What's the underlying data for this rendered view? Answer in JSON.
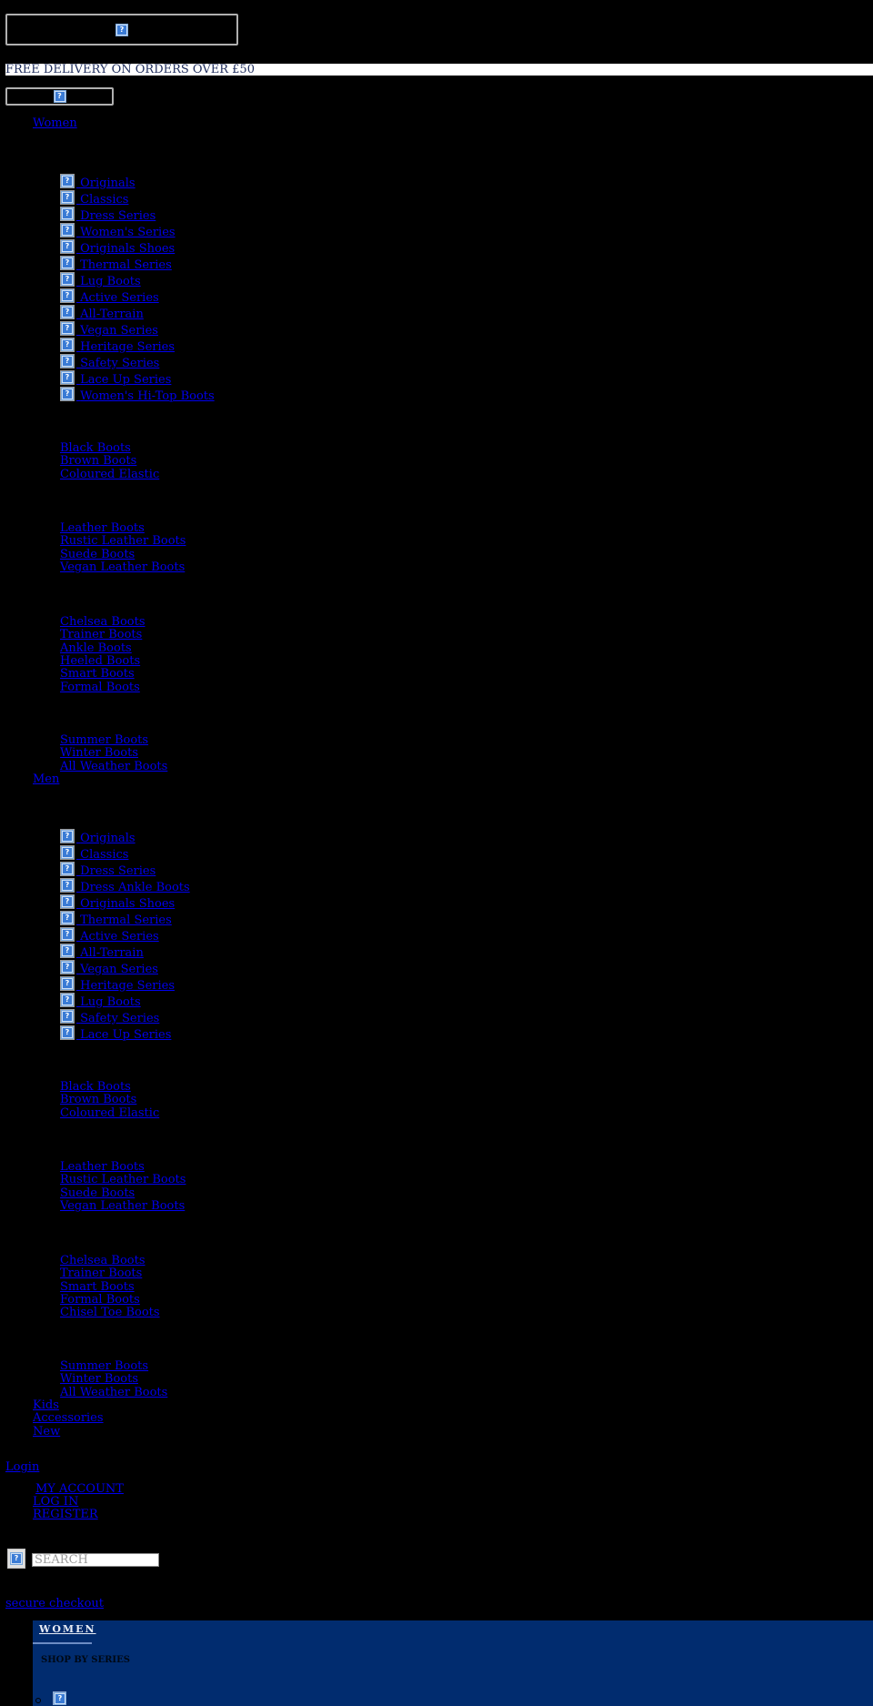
{
  "header": {
    "logo_icon": "broken-image-icon",
    "promo_text": "FREE DELIVERY ON ORDERS OVER £50",
    "menu_icon": "broken-image-icon"
  },
  "nav": {
    "women": {
      "label": "Women",
      "series": [
        "Originals",
        "Classics",
        "Dress Series",
        "Women's Series",
        "Originals Shoes",
        "Thermal Series",
        "Lug Boots",
        "Active Series",
        "All-Terrain",
        "Vegan Series",
        "Heritage Series",
        "Safety Series",
        "Lace Up Series",
        "Women's Hi-Top Boots"
      ],
      "colour": [
        "Black Boots",
        "Brown Boots",
        "Coloured Elastic"
      ],
      "material": [
        "Leather Boots",
        "Rustic Leather Boots",
        "Suede Boots",
        "Vegan Leather Boots"
      ],
      "style": [
        "Chelsea Boots",
        "Trainer Boots",
        "Ankle Boots",
        "Heeled Boots",
        "Smart Boots",
        "Formal Boots"
      ],
      "season": [
        "Summer Boots",
        "Winter Boots",
        "All Weather Boots"
      ]
    },
    "men": {
      "label": "Men",
      "series": [
        "Originals",
        "Classics",
        "Dress Series",
        "Dress Ankle Boots",
        "Originals Shoes",
        "Thermal Series",
        "Active Series",
        "All-Terrain",
        "Vegan Series",
        "Heritage Series",
        "Lug Boots",
        "Safety Series",
        "Lace Up Series"
      ],
      "colour": [
        "Black Boots",
        "Brown Boots",
        "Coloured Elastic"
      ],
      "material": [
        "Leather Boots",
        "Rustic Leather Boots",
        "Suede Boots",
        "Vegan Leather Boots"
      ],
      "style": [
        "Chelsea Boots",
        "Trainer Boots",
        "Smart Boots",
        "Formal Boots",
        "Chisel Toe Boots"
      ],
      "season": [
        "Summer Boots",
        "Winter Boots",
        "All Weather Boots"
      ]
    },
    "kids": "Kids",
    "accessories": "Accessories",
    "new": "New"
  },
  "account": {
    "login": "Login",
    "my_account": " MY ACCOUNT",
    "log_in": "LOG IN",
    "register": "REGISTER"
  },
  "search": {
    "placeholder": "SEARCH",
    "value": ""
  },
  "checkout": {
    "label": "secure checkout"
  },
  "mega_menu": {
    "title": "WOMEN",
    "section": "SHOP BY SERIES",
    "background": "#012c6f"
  },
  "colors": {
    "background": "#000000",
    "link": "#0000ee",
    "promo_text": "#1f2d5c"
  }
}
